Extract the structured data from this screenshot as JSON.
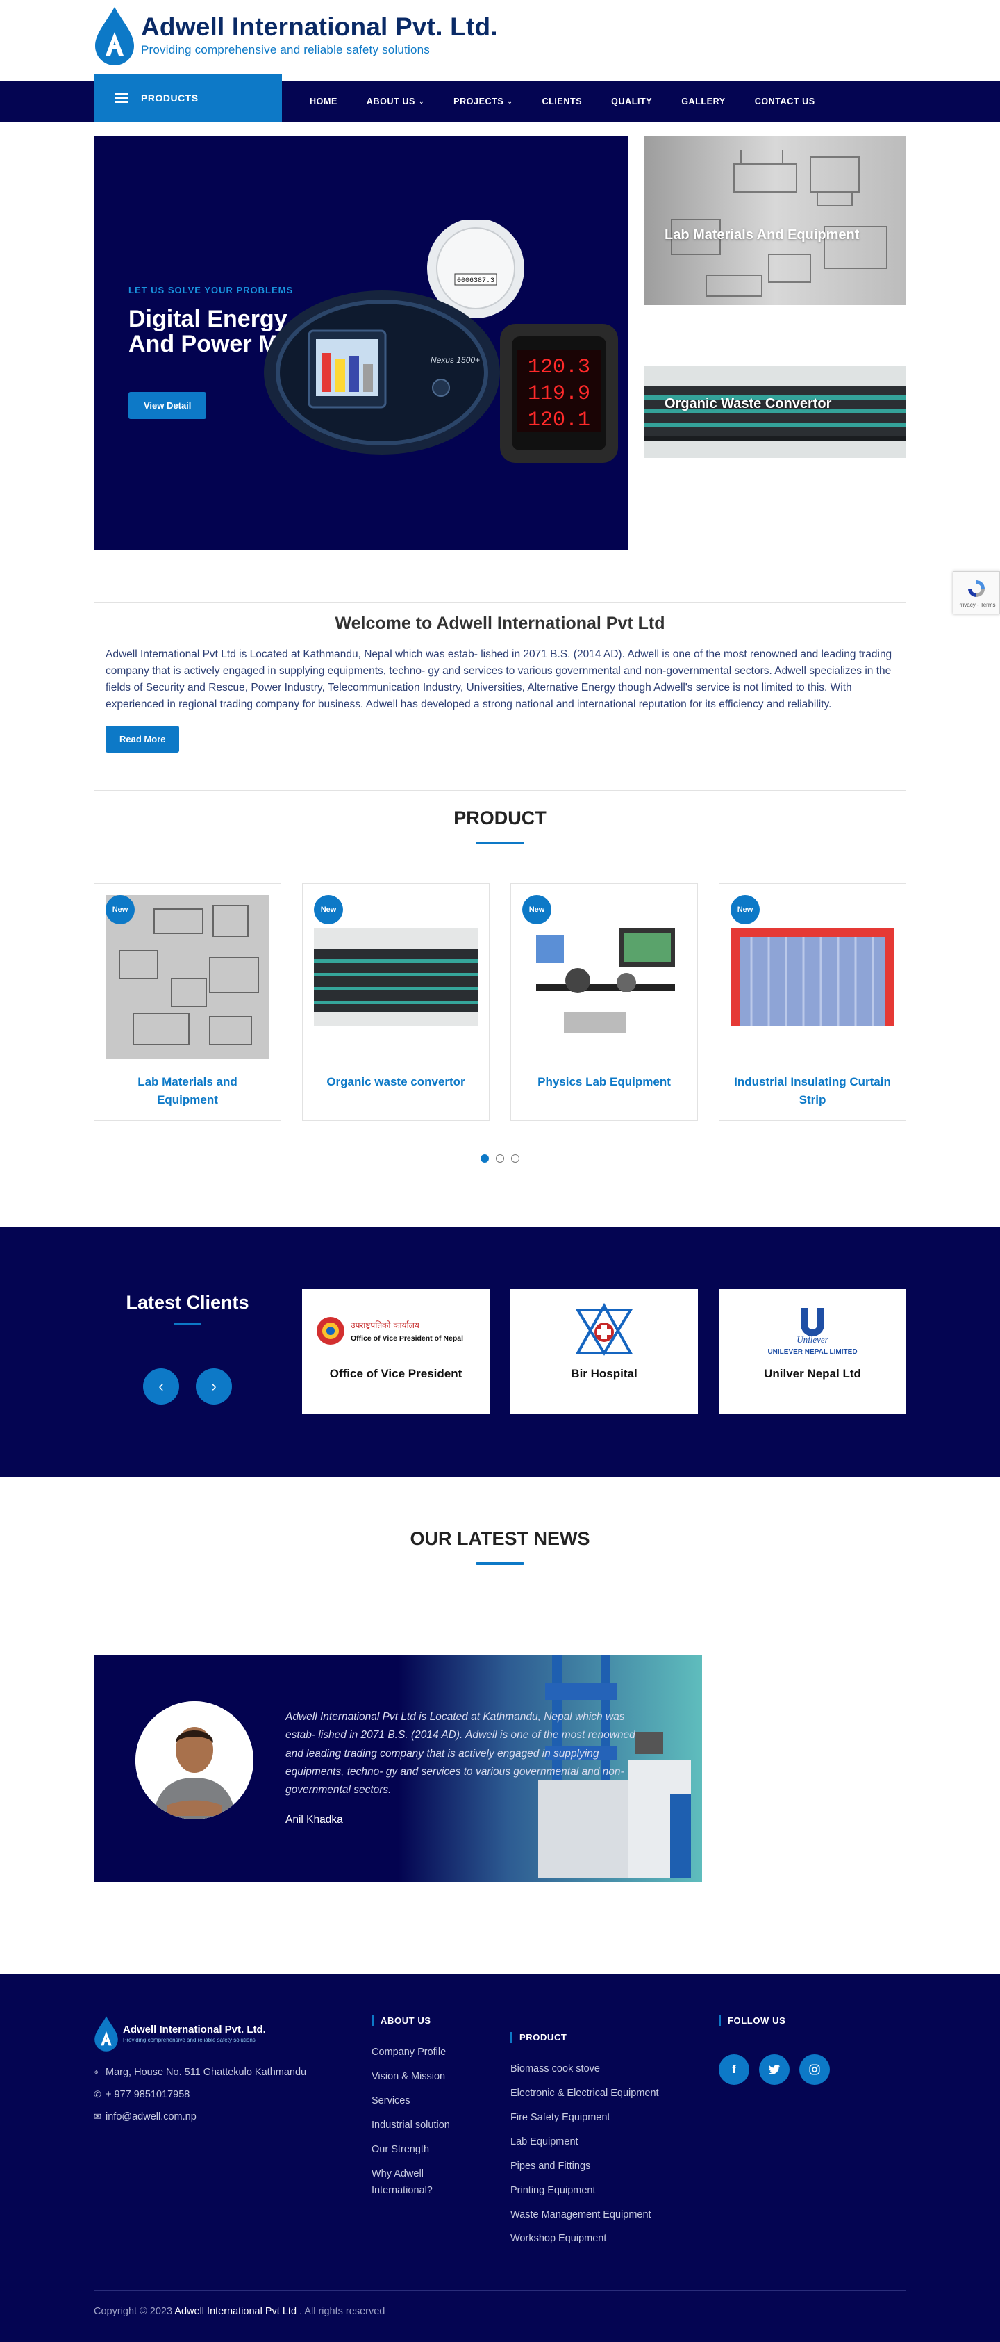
{
  "brand": {
    "name": "Adwell International Pvt. Ltd.",
    "tagline": "Providing comprehensive and reliable safety solutions"
  },
  "nav": {
    "products_label": "PRODUCTS",
    "items": [
      "HOME",
      "ABOUT US",
      "PROJECTS",
      "CLIENTS",
      "QUALITY",
      "GALLERY",
      "CONTACT US"
    ]
  },
  "hero": {
    "eyebrow": "LET US SOLVE YOUR PROBLEMS",
    "title": "Digital Energy And Power Meters",
    "button": "View Detail",
    "meter_readings": [
      "120.3",
      "119.9",
      "120.1"
    ],
    "meter_brand": "Nexus 1500+",
    "meter_counter": "0006387.3",
    "side_cards": [
      "Lab Materials And Equipment",
      "Organic Waste Convertor"
    ]
  },
  "welcome": {
    "title": "Welcome to Adwell International Pvt Ltd",
    "body": "Adwell International Pvt Ltd is Located at Kathmandu, Nepal which was estab- lished in 2071 B.S. (2014 AD). Adwell is one of the most renowned and leading trading company that is actively engaged in supplying equipments, techno- gy and services to various governmental and non-governmental sectors. Adwell specializes in the fields of Security and Rescue, Power Industry, Telecommunication Industry, Universities, Alternative Energy though Adwell's service is not limited to this. With experienced in regional trading company for business. Adwell has developed a strong national and international reputation for its efficiency and reliability.",
    "button": "Read More"
  },
  "products": {
    "title": "PRODUCT",
    "badge": "New",
    "items": [
      {
        "name": "Lab Materials and Equipment"
      },
      {
        "name": "Organic waste convertor"
      },
      {
        "name": "Physics Lab Equipment"
      },
      {
        "name": "Industrial Insulating Curtain Strip"
      }
    ]
  },
  "clients": {
    "title": "Latest Clients",
    "items": [
      {
        "name": "Office of Vice President",
        "logo_text": "उपराष्ट्रपतिको कार्यालय",
        "logo_sub": "Office of Vice President of Nepal"
      },
      {
        "name": "Bir Hospital"
      },
      {
        "name": "Unilver Nepal Ltd",
        "logo_text": "Unilever",
        "logo_sub": "UNILEVER NEPAL LIMITED"
      }
    ]
  },
  "news": {
    "title": "OUR LATEST NEWS",
    "quote": "Adwell International Pvt Ltd is Located at Kathmandu, Nepal which was estab- lished in 2071 B.S. (2014 AD). Adwell is one of the most renowned and leading trading company that is actively engaged in supplying equipments, techno- gy and services to various governmental and non-governmental sectors.",
    "author": "Anil Khadka"
  },
  "footer": {
    "address": "Marg, House No. 511 Ghattekulo Kathmandu",
    "phone": "+ 977 9851017958",
    "email": "info@adwell.com.np",
    "about_title": "ABOUT US",
    "about_links": [
      "Company Profile",
      "Vision & Mission",
      "Services",
      "Industrial solution",
      "Our Strength",
      "Why Adwell International?"
    ],
    "product_title": "PRODUCT",
    "product_links": [
      "Biomass cook stove",
      "Electronic & Electrical Equipment",
      "Fire Safety Equipment",
      "Lab Equipment",
      "Pipes and Fittings",
      "Printing Equipment",
      "Waste Management Equipment",
      "Workshop Equipment"
    ],
    "follow_title": "FOLLOW US",
    "copyright_pre": "Copyright © 2023 ",
    "copyright_name": "Adwell International Pvt Ltd",
    "copyright_post": " . All rights reserved"
  },
  "colors": {
    "navy": "#040552",
    "blue": "#0d79c7",
    "link_blue": "#1994de"
  }
}
